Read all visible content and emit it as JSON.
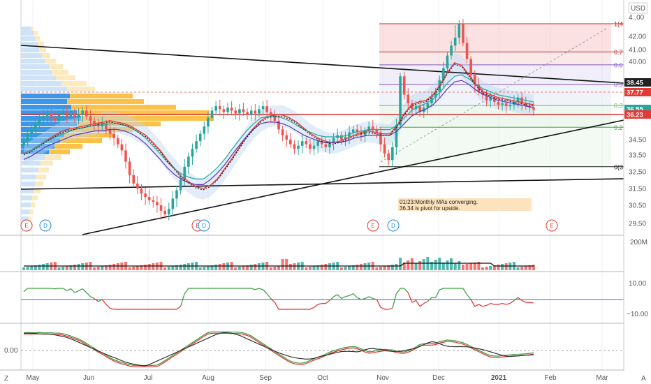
{
  "currency": "USD",
  "corner_letters": {
    "left": "Z",
    "right": "A"
  },
  "chart_data": {
    "type": "candlestick",
    "price_axis": {
      "ticks": [
        29.5,
        30.5,
        31.5,
        32.5,
        33.5,
        34.5,
        40.0,
        41.0,
        42.0
      ],
      "top_partial_label": "4..00"
    },
    "time_axis": {
      "labels": [
        "May",
        "Jun",
        "Jul",
        "Aug",
        "Sep",
        "Oct",
        "Nov",
        "Dec",
        "2021",
        "Feb",
        "Mar"
      ]
    },
    "price_tags": [
      {
        "label": "38.45",
        "value": 38.45,
        "color": "#222222"
      },
      {
        "label": "37.77",
        "value": 37.77,
        "color": "#e53935"
      },
      {
        "label": "36.55",
        "value": 36.55,
        "color": "#26a69a"
      },
      {
        "label": "36.23",
        "value": 36.23,
        "color": "#e53935"
      }
    ],
    "fib_levels": [
      {
        "label": "1(4",
        "value": 42.4,
        "color": "#c62828"
      },
      {
        "label": "0.7",
        "value": 40.8,
        "color": "#c62828"
      },
      {
        "label": "0.6",
        "value": 39.75,
        "color": "#7e57c2"
      },
      {
        "label": "0.5",
        "value": 38.3,
        "color": "#7e57c2"
      },
      {
        "label": "0.3",
        "value": 36.85,
        "color": "#66bb6a"
      },
      {
        "label": "0.2",
        "value": 35.35,
        "color": "#43a047"
      },
      {
        "label": "0(3",
        "value": 32.8,
        "color": "#222222"
      }
    ],
    "annotation": {
      "line1": "01/23:Monthly MAs converging.",
      "line2": "36.34 is pivot for upside."
    },
    "events": [
      {
        "type": "E",
        "color": "#e53935"
      },
      {
        "type": "D",
        "color": "#1e88e5"
      },
      {
        "type": "E",
        "color": "#e53935"
      },
      {
        "type": "D",
        "color": "#1e88e5"
      },
      {
        "type": "E",
        "color": "#e53935"
      },
      {
        "type": "D",
        "color": "#1e88e5"
      },
      {
        "type": "E",
        "color": "#e53935"
      }
    ],
    "volume_axis": {
      "ticks": [
        "200M"
      ]
    },
    "oscillator1_axis": {
      "ticks": [
        "10.00",
        "−10.00"
      ]
    },
    "oscillator2_axis": {
      "ticks": [
        "0.00"
      ]
    },
    "closes": [
      34.4,
      34.9,
      35.2,
      35.6,
      35.9,
      36.1,
      36.3,
      36.0,
      35.8,
      36.2,
      36.4,
      36.1,
      36.3,
      36.0,
      36.2,
      36.5,
      36.1,
      35.8,
      35.6,
      35.4,
      35.6,
      35.2,
      34.9,
      34.6,
      34.2,
      33.8,
      33.1,
      32.3,
      31.8,
      31.5,
      31.2,
      31.0,
      30.8,
      30.7,
      30.5,
      30.2,
      30.0,
      30.3,
      30.9,
      31.4,
      32.0,
      32.8,
      33.4,
      33.9,
      34.4,
      34.9,
      35.4,
      36.0,
      36.5,
      36.8,
      36.6,
      36.4,
      36.7,
      36.5,
      36.3,
      36.6,
      36.4,
      36.2,
      36.5,
      36.3,
      36.6,
      36.8,
      36.4,
      36.2,
      35.8,
      35.2,
      34.8,
      34.5,
      34.2,
      33.9,
      34.1,
      34.4,
      34.2,
      33.9,
      34.1,
      34.4,
      34.2,
      34.0,
      34.3,
      34.6,
      34.8,
      34.5,
      34.7,
      35.0,
      35.2,
      35.0,
      34.8,
      35.1,
      35.4,
      35.2,
      35.0,
      34.2,
      33.6,
      33.2,
      34.0,
      35.5,
      38.9,
      37.6,
      37.0,
      36.6,
      36.8,
      36.4,
      36.7,
      37.0,
      37.4,
      37.8,
      38.6,
      39.5,
      40.5,
      41.3,
      41.9,
      42.4,
      41.5,
      40.2,
      39.0,
      38.3,
      37.8,
      37.6,
      37.2,
      37.4,
      37.1,
      36.9,
      37.0,
      36.8,
      36.9,
      37.1,
      37.4,
      37.0,
      36.8,
      36.7,
      36.55
    ],
    "sma_fast": [
      33.6,
      33.8,
      34.1,
      34.4,
      34.7,
      35.0,
      35.2,
      35.3,
      35.4,
      35.5,
      35.6,
      35.7,
      35.8,
      35.7,
      35.6,
      35.4,
      35.1,
      34.8,
      34.3,
      33.8,
      33.2,
      32.7,
      32.2,
      31.9,
      31.6,
      31.5,
      31.7,
      32.1,
      32.7,
      33.3,
      34.0,
      34.7,
      35.3,
      35.8,
      36.1,
      36.2,
      36.2,
      36.0,
      35.7,
      35.3,
      34.9,
      34.6,
      34.4,
      34.3,
      34.4,
      34.6,
      34.8,
      35.0,
      35.1,
      35.0,
      34.9,
      34.9,
      35.5,
      36.3,
      36.9,
      37.1,
      37.2,
      37.6,
      38.3,
      39.2,
      39.9,
      39.7,
      39.0,
      38.3,
      37.8,
      37.6,
      37.4,
      37.3,
      37.2,
      37.1,
      37.0,
      36.9
    ],
    "sma_slow": [
      33.4,
      33.6,
      33.9,
      34.2,
      34.4,
      34.6,
      34.8,
      35.0,
      35.1,
      35.2,
      35.3,
      35.3,
      35.4,
      35.4,
      35.3,
      35.1,
      34.8,
      34.4,
      33.9,
      33.4,
      32.9,
      32.5,
      32.2,
      32.0,
      31.9,
      31.9,
      32.2,
      32.6,
      33.1,
      33.7,
      34.3,
      34.9,
      35.4,
      35.8,
      35.9,
      35.9,
      35.8,
      35.6,
      35.3,
      35.0,
      34.8,
      34.6,
      34.5,
      34.5,
      34.5,
      34.6,
      34.8,
      34.9,
      35.0,
      35.0,
      35.0,
      35.0,
      35.3,
      35.8,
      36.3,
      36.6,
      36.8,
      37.1,
      37.6,
      38.2,
      38.7,
      38.8,
      38.5,
      38.1,
      37.8,
      37.6,
      37.4,
      37.3,
      37.2,
      37.1,
      37.0,
      36.9
    ]
  }
}
